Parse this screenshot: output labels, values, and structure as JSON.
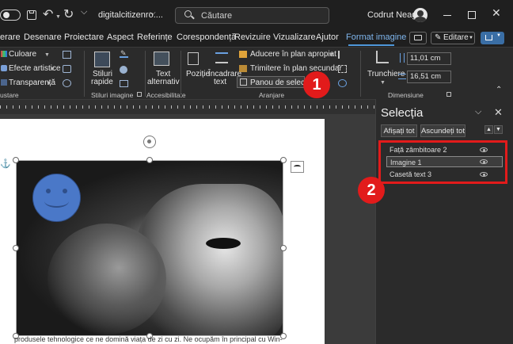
{
  "titlebar": {
    "document_name": "digitalcitizenro....",
    "search_placeholder": "Căutare",
    "user_name": "Codrut Neagu"
  },
  "tabs": [
    {
      "label": "erare"
    },
    {
      "label": "Desenare"
    },
    {
      "label": "Proiectare"
    },
    {
      "label": "Aspect"
    },
    {
      "label": "Referințe"
    },
    {
      "label": "Corespondență"
    },
    {
      "label": "Revizuire"
    },
    {
      "label": "Vizualizare"
    },
    {
      "label": "Ajutor"
    },
    {
      "label": "Format imagine"
    }
  ],
  "tab_actions": {
    "edit_label": "Editare"
  },
  "ribbon": {
    "culoare": "Culoare",
    "efecte": "Efecte artistice",
    "transparenta": "Transparență",
    "ajustare": "ustare",
    "stiluri_rapide_1": "Stiluri",
    "stiluri_rapide_2": "rapide",
    "stiluri_imagine": "Stiluri imagine",
    "text_alt_1": "Text",
    "text_alt_2": "alternativ",
    "accesibilitate": "Accesibilitate",
    "pozitie": "Poziție",
    "incadrare_1": "Încadrare",
    "incadrare_2": "text",
    "aducere": "Aducere în plan apropiat",
    "trimitere": "Trimitere în plan secundar",
    "panou": "Panou de selecție",
    "aranjare": "Aranjare",
    "trunchiere": "Trunchiere",
    "height": "11,01 cm",
    "width": "16,51 cm",
    "dimensiune": "Dimensiune"
  },
  "document": {
    "body_text": "produsele tehnologice ce ne domină viața de zi cu zi. Ne ocupăm în principal cu Win-"
  },
  "selection_pane": {
    "title": "Selecția",
    "show_all": "Afișați tot",
    "hide_all": "Ascundeți tot",
    "items": [
      {
        "label": "Față zâmbitoare 2",
        "selected": false
      },
      {
        "label": "Imagine 1",
        "selected": true
      },
      {
        "label": "Casetă text 3",
        "selected": false
      }
    ]
  },
  "annotations": [
    {
      "label": "1"
    },
    {
      "label": "2"
    }
  ],
  "colors": {
    "accent": "#4f97d9",
    "annotation": "#e21b1b",
    "smiley": "#4a78c8"
  }
}
